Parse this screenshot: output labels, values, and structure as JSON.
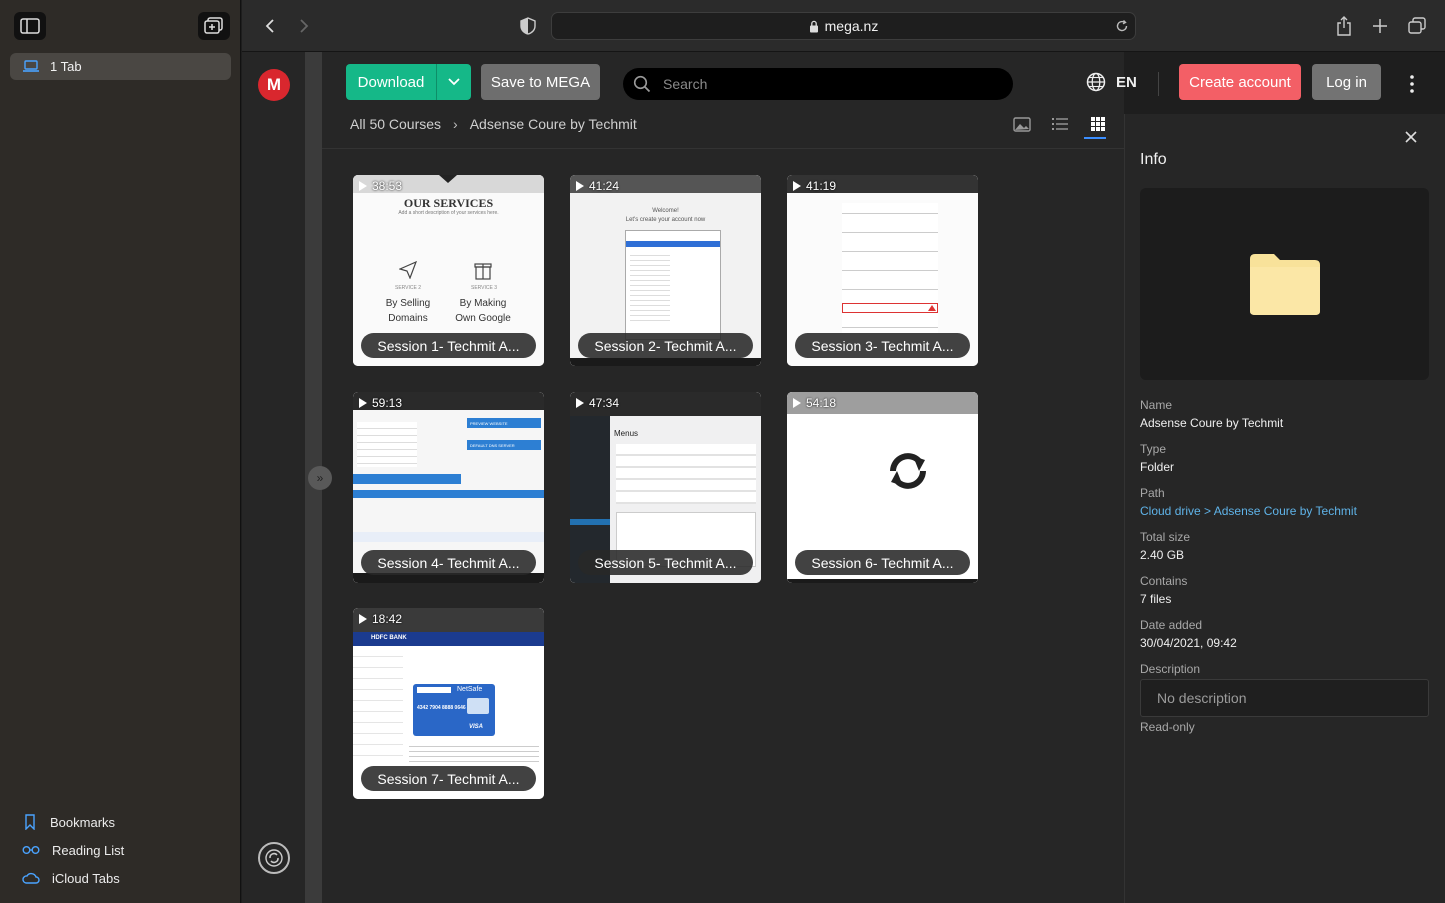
{
  "browser": {
    "url": "mega.nz"
  },
  "sidebar": {
    "tab_label": "1 Tab",
    "links": [
      {
        "label": "Bookmarks",
        "icon": "bookmark-icon"
      },
      {
        "label": "Reading List",
        "icon": "reading-list-icon"
      },
      {
        "label": "iCloud Tabs",
        "icon": "icloud-icon"
      }
    ]
  },
  "mega": {
    "logo_letter": "M",
    "download_label": "Download",
    "save_label": "Save to MEGA",
    "search_placeholder": "Search",
    "language": "EN",
    "create_account_label": "Create account",
    "login_label": "Log in",
    "breadcrumb": {
      "root": "All 50 Courses",
      "current": "Adsense Coure by Techmit"
    },
    "accent_green": "#15b888",
    "accent_red": "#f35f66"
  },
  "tiles": [
    {
      "duration": "38:53",
      "caption": "Session 1- Techmit A..."
    },
    {
      "duration": "41:24",
      "caption": "Session 2- Techmit A..."
    },
    {
      "duration": "41:19",
      "caption": "Session 3- Techmit A..."
    },
    {
      "duration": "59:13",
      "caption": "Session 4- Techmit A..."
    },
    {
      "duration": "47:34",
      "caption": "Session 5- Techmit A..."
    },
    {
      "duration": "54:18",
      "caption": "Session 6- Techmit A..."
    },
    {
      "duration": "18:42",
      "caption": "Session 7- Techmit A..."
    }
  ],
  "thumb_text": {
    "services_heading": "OUR SERVICES",
    "services_sub": "Add a short description of your services here.",
    "service2_tag": "SERVICE 2",
    "service2_name": "By Selling Domains",
    "service3_tag": "SERVICE 3",
    "service3_name": "By Making Own Google",
    "welcome": "Welcome!",
    "create_account": "Let's create your account now",
    "preview_website": "PREVIEW WEBSITE",
    "default_dns": "DEFAULT DNS SERVER",
    "menus": "Menus",
    "hdfc": "HDFC BANK",
    "net_safe": "NetSafe",
    "card_number": "4342 7904 8888 0646",
    "visa": "VISA"
  },
  "info": {
    "title": "Info",
    "name_label": "Name",
    "name_value": "Adsense Coure by Techmit",
    "type_label": "Type",
    "type_value": "Folder",
    "path_label": "Path",
    "path_value": "Cloud drive > Adsense Coure by Techmit",
    "size_label": "Total size",
    "size_value": "2.40 GB",
    "contains_label": "Contains",
    "contains_value": "7 files",
    "date_label": "Date added",
    "date_value": "30/04/2021, 09:42",
    "desc_label": "Description",
    "desc_placeholder": "No description",
    "readonly": "Read-only"
  }
}
